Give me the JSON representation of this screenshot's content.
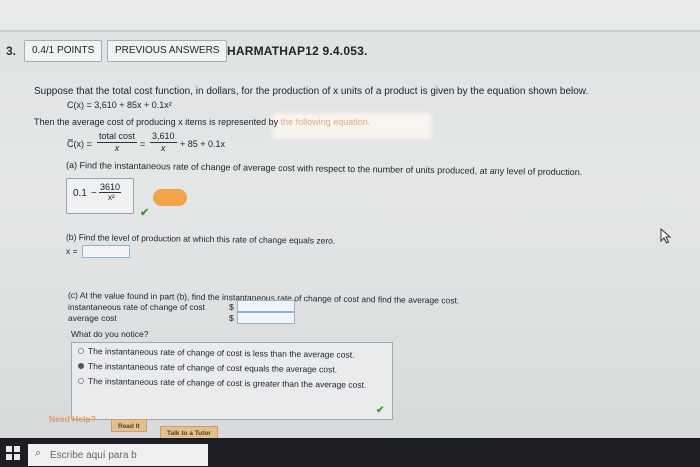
{
  "question": {
    "number": "3.",
    "points_label": "0.4/1 POINTS",
    "previous_answers_label": "PREVIOUS ANSWERS",
    "code": "HARMATHAP12 9.4.053."
  },
  "prompt": {
    "intro": "Suppose that the total cost function, in dollars, for the production of x units of a product is given by the equation shown below.",
    "cost_function": "C(x) = 3,610 + 85x + 0.1x²",
    "average_intro": "Then the average cost of producing x items is represented by",
    "average_intro_faded": "the following equation.",
    "average_lhs": "C̅(x) =",
    "avg_frac1_num": "total cost",
    "avg_frac1_den": "x",
    "equals": "=",
    "avg_frac2_num": "3,610",
    "avg_frac2_den": "x",
    "avg_tail": "+ 85 + 0.1x"
  },
  "part_a": {
    "text": "(a) Find the instantaneous rate of change of average cost with respect to the number of units produced, at any level of production.",
    "answer_value": "0.1",
    "answer_dash": "−",
    "answer_frac_num": "3610",
    "answer_frac_den": "x²",
    "status": "correct"
  },
  "part_b": {
    "text": "(b) Find the level of production at which this rate of change equals zero.",
    "var_label": "x =",
    "value": ""
  },
  "part_c": {
    "text": "(c) At the value found in part (b), find the instantaneous rate of change of cost and find the average cost.",
    "rate_label": "instantaneous rate of change of cost",
    "avg_label": "average cost",
    "currency": "$",
    "rate_value": "",
    "avg_value": ""
  },
  "notice": {
    "question": "What do you notice?",
    "options": [
      "The instantaneous rate of change of cost is less than the average cost.",
      "The instantaneous rate of change of cost equals the average cost.",
      "The instantaneous rate of change of cost is greater than the average cost."
    ],
    "selected_index": 1,
    "status": "correct"
  },
  "help": {
    "label": "Need Help?",
    "read_it": "Read It",
    "talk_to_tutor": "Talk to a Tutor"
  },
  "taskbar": {
    "search_placeholder": "Escribe aquí para b"
  },
  "icons": {
    "check": "checkmark-icon",
    "windows": "windows-logo-icon",
    "search": "magnifier-icon",
    "cursor": "arrow-cursor-icon"
  },
  "colors": {
    "check_green": "#3c9a3a",
    "faded_text": "#e0a98f",
    "input_border": "#8eb2cf",
    "help_button": "#e2c093",
    "taskbar": "#1c1e21"
  }
}
